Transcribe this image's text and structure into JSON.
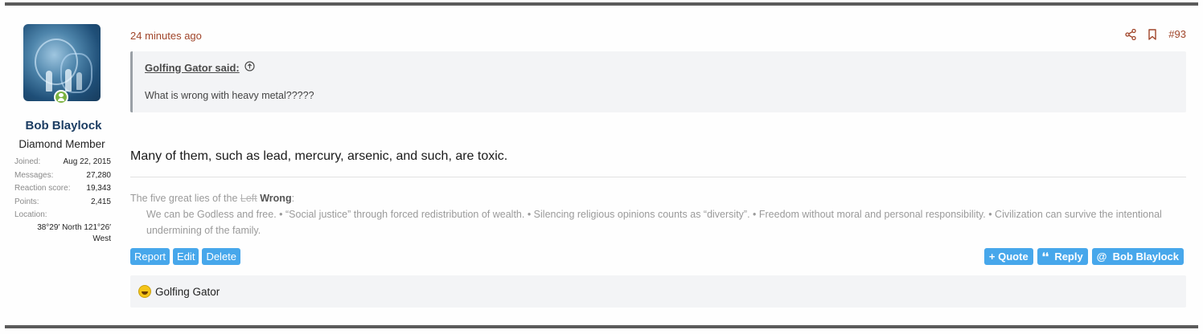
{
  "user": {
    "name": "Bob Blaylock",
    "title": "Diamond Member",
    "stats": [
      {
        "label": "Joined:",
        "value": "Aug 22, 2015"
      },
      {
        "label": "Messages:",
        "value": "27,280"
      },
      {
        "label": "Reaction score:",
        "value": "19,343"
      },
      {
        "label": "Points:",
        "value": "2,415"
      }
    ],
    "location_label": "Location:",
    "location_value": "38°29′ North 121°26′ West"
  },
  "post": {
    "timestamp": "24 minutes ago",
    "number": "#93",
    "quote": {
      "author": "Golfing Gator said:",
      "text": "What is wrong with heavy metal?????"
    },
    "message": "Many of them, such as lead, mercury, arsenic, and such, are toxic.",
    "signature": {
      "prefix": "The five great lies of the",
      "struck": "Left",
      "bold": "Wrong",
      "suffix": ":",
      "body": "We can be Godless and free. • “Social justice” through forced redistribution of wealth. • Silencing religious opinions counts as “diversity”. • Freedom without moral and personal responsibility. • Civilization can survive the intentional undermining of the family."
    },
    "actions_left": [
      "Report",
      "Edit",
      "Delete"
    ],
    "actions_right": {
      "quote": "+ Quote",
      "reply": "Reply",
      "mention": "Bob Blaylock"
    },
    "reactions": {
      "users": "Golfing Gator"
    }
  },
  "colors": {
    "accent": "#a0452a",
    "button": "#47a7eb",
    "username": "#1c3d63"
  }
}
